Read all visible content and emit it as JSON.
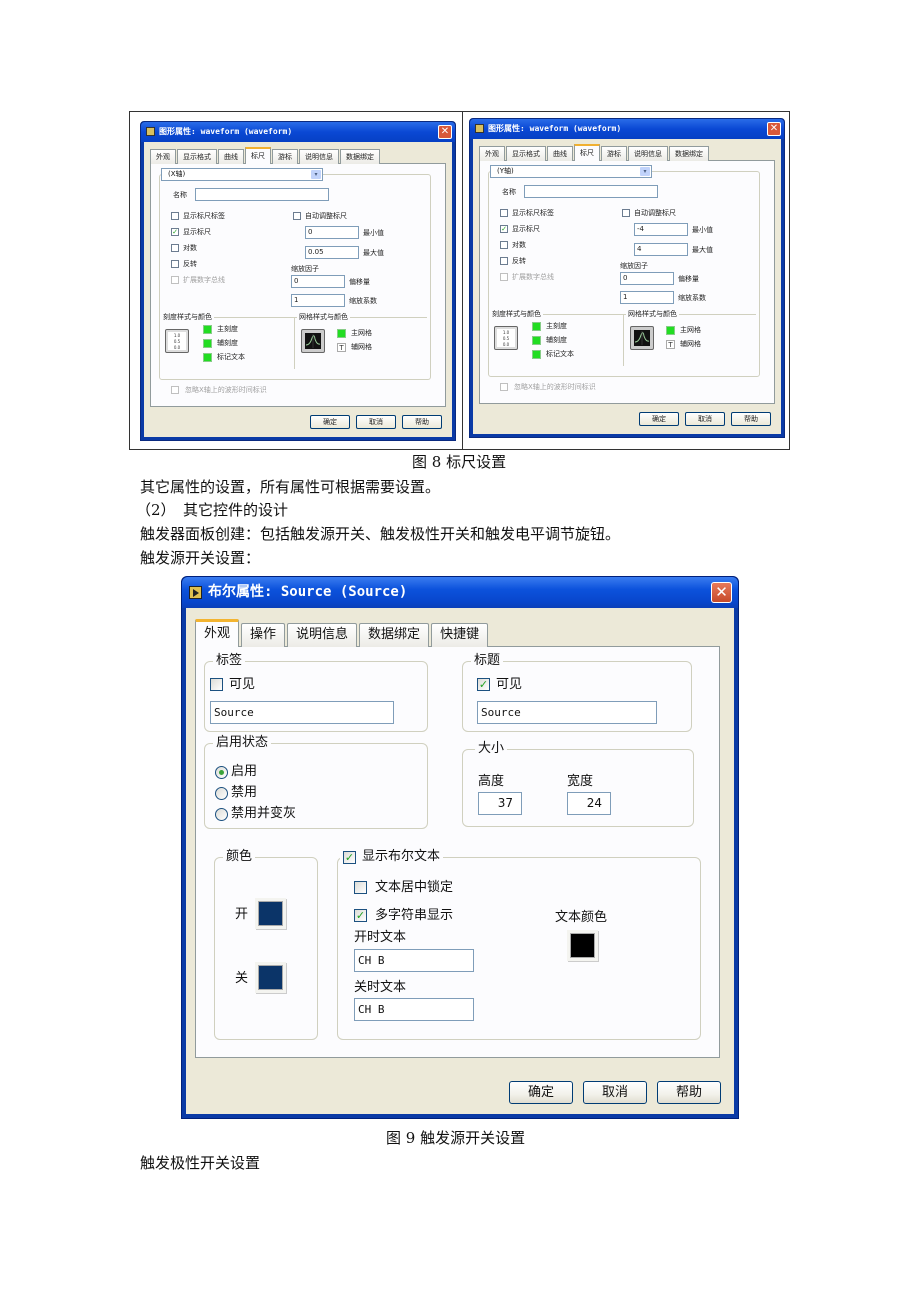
{
  "figure8": {
    "caption": "图 8 标尺设置",
    "dialogs": [
      {
        "title": "图形属性: waveform (waveform)",
        "tabs": [
          "外观",
          "显示格式",
          "曲线",
          "标尺",
          "游标",
          "说明信息",
          "数据绑定"
        ],
        "active_tab": "标尺",
        "axis_select": "(X轴)",
        "name_label": "名称",
        "name_value": "",
        "show_scale_label": {
          "label": "显示标尺标签",
          "checked": false
        },
        "show_scale": {
          "label": "显示标尺",
          "checked": true
        },
        "log": {
          "label": "对数",
          "checked": false
        },
        "invert": {
          "label": "反转",
          "checked": false
        },
        "expand_digital": {
          "label": "扩展数字总线",
          "checked": false,
          "disabled": true
        },
        "autoscale": {
          "label": "自动调整标尺",
          "checked": false
        },
        "min_value": "0",
        "min_label": "最小值",
        "max_value": "0.05",
        "max_label": "最大值",
        "scaling_factor_label": "缩放因子",
        "offset_value": "0",
        "offset_label": "偏移量",
        "multiplier_value": "1",
        "multiplier_label": "缩放系数",
        "scale_style_group": "刻度样式与颜色",
        "major_tick": "主刻度",
        "minor_tick": "辅刻度",
        "marker_text": "标记文本",
        "scale_icon_lines": [
          "1.0",
          "0.5",
          "0.0"
        ],
        "grid_style_group": "网格样式与颜色",
        "major_grid": "主网格",
        "minor_grid": "辅网格",
        "ignore_timestamp": {
          "label": "忽略X轴上的波形时间标识",
          "checked": false,
          "disabled": true
        },
        "buttons": {
          "ok": "确定",
          "cancel": "取消",
          "help": "帮助"
        }
      },
      {
        "title": "图形属性: waveform (waveform)",
        "tabs": [
          "外观",
          "显示格式",
          "曲线",
          "标尺",
          "游标",
          "说明信息",
          "数据绑定"
        ],
        "active_tab": "标尺",
        "axis_select": "(Y轴)",
        "name_label": "名称",
        "name_value": "",
        "show_scale_label": {
          "label": "显示标尺标签",
          "checked": false
        },
        "show_scale": {
          "label": "显示标尺",
          "checked": true
        },
        "log": {
          "label": "对数",
          "checked": false
        },
        "invert": {
          "label": "反转",
          "checked": false
        },
        "expand_digital": {
          "label": "扩展数字总线",
          "checked": false,
          "disabled": true
        },
        "autoscale": {
          "label": "自动调整标尺",
          "checked": false
        },
        "min_value": "-4",
        "min_label": "最小值",
        "max_value": "4",
        "max_label": "最大值",
        "scaling_factor_label": "缩放因子",
        "offset_value": "0",
        "offset_label": "偏移量",
        "multiplier_value": "1",
        "multiplier_label": "缩放系数",
        "scale_style_group": "刻度样式与颜色",
        "major_tick": "主刻度",
        "minor_tick": "辅刻度",
        "marker_text": "标记文本",
        "scale_icon_lines": [
          "1.0",
          "0.5",
          "0.0"
        ],
        "grid_style_group": "网格样式与颜色",
        "major_grid": "主网格",
        "minor_grid": "辅网格",
        "ignore_timestamp": {
          "label": "忽略X轴上的波形时间标识",
          "checked": false,
          "disabled": true
        },
        "buttons": {
          "ok": "确定",
          "cancel": "取消",
          "help": "帮助"
        }
      }
    ]
  },
  "paragraphs": {
    "p1": "其它属性的设置，所有属性可根据需要设置。",
    "p2": "（2）　其它控件的设计",
    "p3": "触发器面板创建：包括触发源开关、触发极性开关和触发电平调节旋钮。",
    "p4": "触发源开关设置：",
    "p5": "触发极性开关设置"
  },
  "figure9": {
    "caption": "图 9  触发源开关设置",
    "dialog": {
      "title": "布尔属性: Source (Source)",
      "tabs": [
        "外观",
        "操作",
        "说明信息",
        "数据绑定",
        "快捷键"
      ],
      "active_tab": "外观",
      "label_group": {
        "title": "标签",
        "visible_label": "可见",
        "visible_checked": false,
        "value": "Source"
      },
      "caption_group": {
        "title": "标题",
        "visible_label": "可见",
        "visible_checked": true,
        "value": "Source"
      },
      "enable_group": {
        "title": "启用状态",
        "options": [
          "启用",
          "禁用",
          "禁用并变灰"
        ],
        "selected": "启用"
      },
      "size_group": {
        "title": "大小",
        "height_label": "高度",
        "height_value": "37",
        "width_label": "宽度",
        "width_value": "24"
      },
      "color_group": {
        "title": "颜色",
        "on_label": "开",
        "on_color": "#0b3468",
        "off_label": "关",
        "off_color": "#0b3468"
      },
      "bool_text_group": {
        "title": "显示布尔文本",
        "title_checked": true,
        "lock_center": {
          "label": "文本居中锁定",
          "checked": false
        },
        "multi_string": {
          "label": "多字符串显示",
          "checked": true
        },
        "on_text_label": "开时文本",
        "on_text_value": "CH B",
        "off_text_label": "关时文本",
        "off_text_value": "CH B",
        "text_color_label": "文本颜色",
        "text_color": "#000000"
      },
      "buttons": {
        "ok": "确定",
        "cancel": "取消",
        "help": "帮助"
      }
    }
  }
}
